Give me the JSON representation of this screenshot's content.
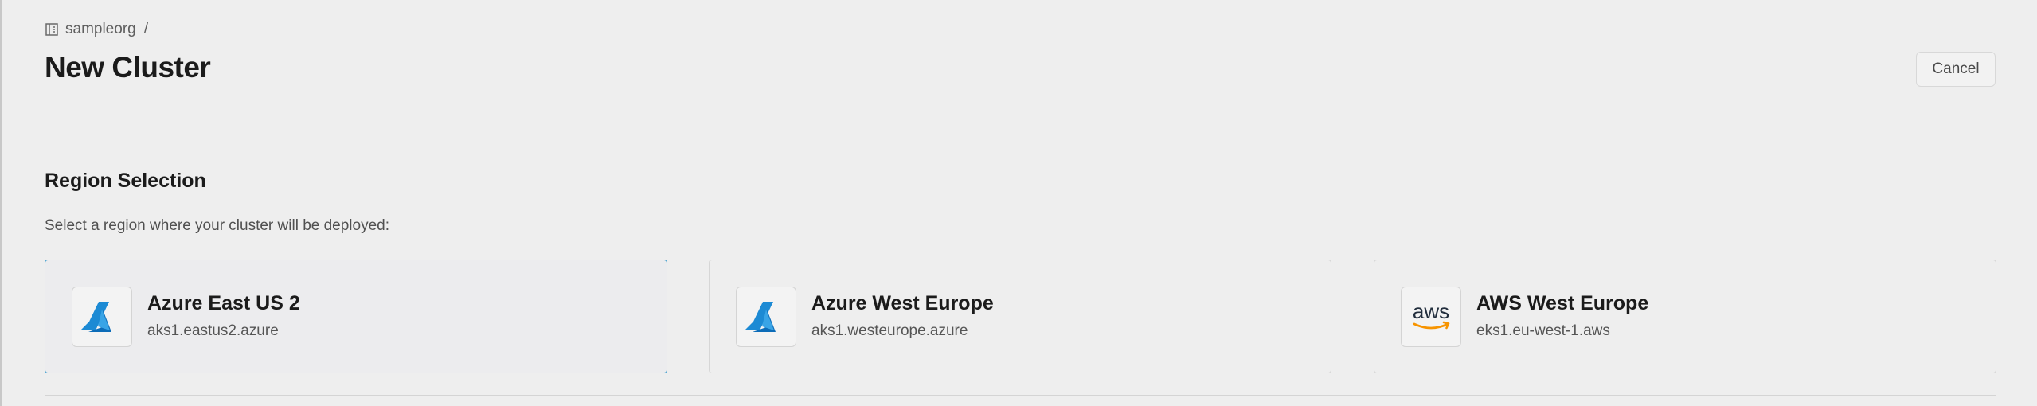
{
  "breadcrumb": {
    "org": "sampleorg",
    "separator": "/",
    "icon": "building-icon"
  },
  "header": {
    "title": "New Cluster",
    "cancel_label": "Cancel"
  },
  "region_section": {
    "title": "Region Selection",
    "description": "Select a region where your cluster will be deployed:",
    "regions": [
      {
        "name": "Azure East US 2",
        "host": "aks1.eastus2.azure",
        "provider": "azure",
        "icon": "azure-logo-icon",
        "selected": true
      },
      {
        "name": "Azure West Europe",
        "host": "aks1.westeurope.azure",
        "provider": "azure",
        "icon": "azure-logo-icon",
        "selected": false
      },
      {
        "name": "AWS West Europe",
        "host": "eks1.eu-west-1.aws",
        "provider": "aws",
        "icon": "aws-logo-icon",
        "logo_text": "aws",
        "selected": false
      }
    ]
  },
  "colors": {
    "background": "#eeeeee",
    "selected_border": "#4ba3cf",
    "azure_blue": "#0a86d6",
    "aws_orange": "#f79400",
    "aws_text": "#232f3e"
  }
}
